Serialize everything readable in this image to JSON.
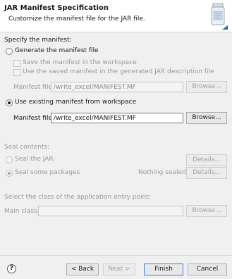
{
  "header": {
    "title": "JAR Manifest Specification",
    "description": "Customize the manifest file for the JAR file."
  },
  "manifest": {
    "section_label": "Specify the manifest:",
    "generate_label": "Generate the manifest file",
    "save_in_workspace_label": "Save the manifest in the workspace",
    "use_saved_label": "Use the saved manifest in the generated JAR description file",
    "gen_file_label": "Manifest file:",
    "gen_file_value": "/write_excel/MANIFEST.MF",
    "gen_browse_label": "Browse...",
    "use_existing_label": "Use existing manifest from workspace",
    "existing_file_label": "Manifest file:",
    "existing_file_value": "/write_excel/MANIFEST.MF",
    "existing_browse_label": "Browse..."
  },
  "seal": {
    "section_label": "Seal contents:",
    "seal_jar_label": "Seal the JAR",
    "seal_jar_details": "Details...",
    "seal_some_label": "Seal some packages",
    "nothing_sealed": "Nothing sealed",
    "seal_some_details": "Details..."
  },
  "entry": {
    "section_label": "Select the class of the application entry point:",
    "main_class_label": "Main class:",
    "main_class_value": "",
    "browse_label": "Browse..."
  },
  "footer": {
    "help": "?",
    "back": "< Back",
    "next": "Next >",
    "finish": "Finish",
    "cancel": "Cancel"
  }
}
